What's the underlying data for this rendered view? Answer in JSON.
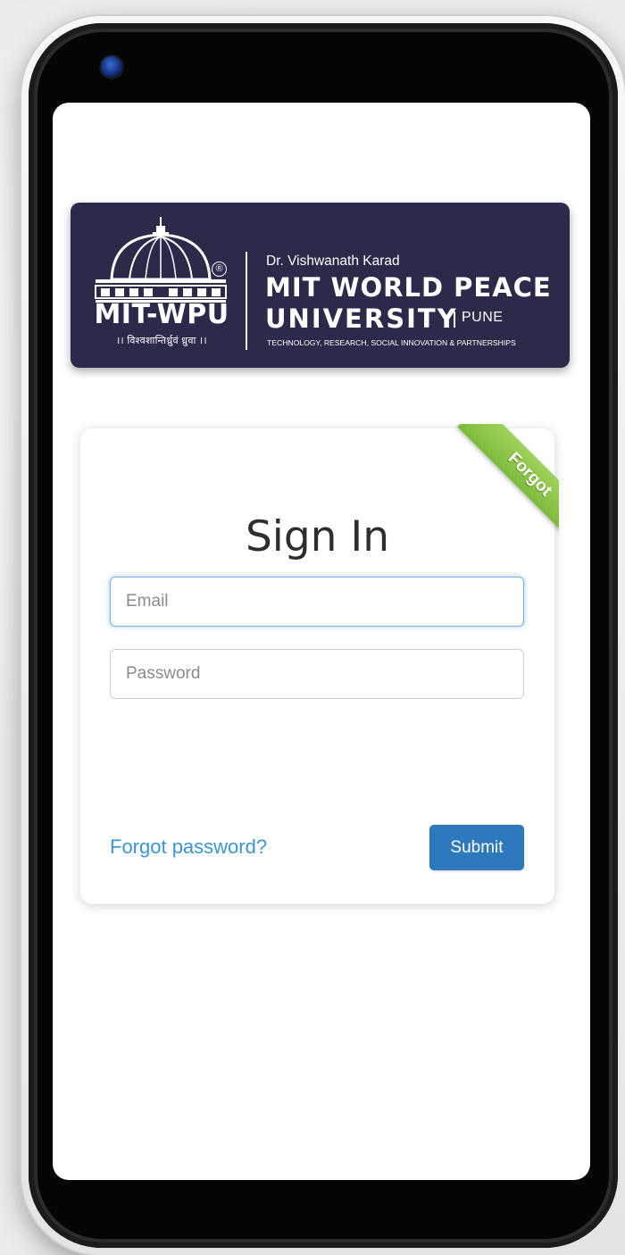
{
  "banner": {
    "logo_abbr": "MIT-WPU",
    "registered_mark": "®",
    "motto": "।। विश्वशान्तिर्ध्रुवं ध्रुवा ।।",
    "founder_line": "Dr. Vishwanath Karad",
    "university_line1": "MIT WORLD PEACE",
    "university_line2": "UNIVERSITY",
    "location": "PUNE",
    "tagline": "TECHNOLOGY, RESEARCH, SOCIAL INNOVATION & PARTNERSHIPS",
    "background_color": "#2c2a4a"
  },
  "login": {
    "ribbon_label": "Forgot",
    "title": "Sign In",
    "email_placeholder": "Email",
    "password_placeholder": "Password",
    "forgot_link": "Forgot password?",
    "submit_label": "Submit",
    "accent_color": "#2e79be",
    "link_color": "#3a96d6",
    "ribbon_color": "#7cbb3b"
  }
}
